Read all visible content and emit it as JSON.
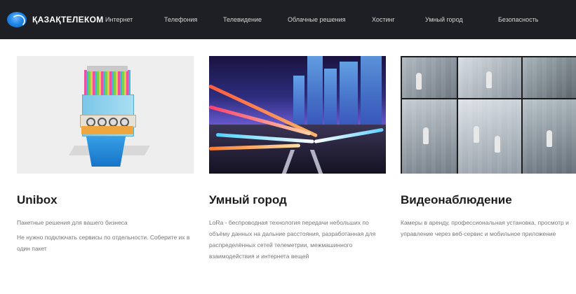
{
  "header": {
    "logo_text": "ҚАЗАҚТЕЛЕКОМ",
    "menu": [
      "Интернет",
      "Телефония",
      "Телевидение",
      "Облачные решения",
      "Хостинг",
      "Умный город",
      "Безопасность"
    ]
  },
  "cards": [
    {
      "title": "Unibox",
      "desc": [
        "Пакетные решения для вашего бизнеса",
        "Не нужно подключать сервисы по отдельности. Соберите их в один пакет"
      ]
    },
    {
      "title": "Умный город",
      "desc": [
        "LoRa - беспроводная технология передачи небольших по объёму данных на дальние расстояния, разработанная для распределённых сетей телеметрии, межмашинного взаимодействия и интернета вещей"
      ]
    },
    {
      "title": "Видеонаблюдение",
      "desc": [
        "Камеры в аренду, профессиональная установка, просмотр и управление через веб-сервис и мобильное приложение"
      ]
    }
  ]
}
